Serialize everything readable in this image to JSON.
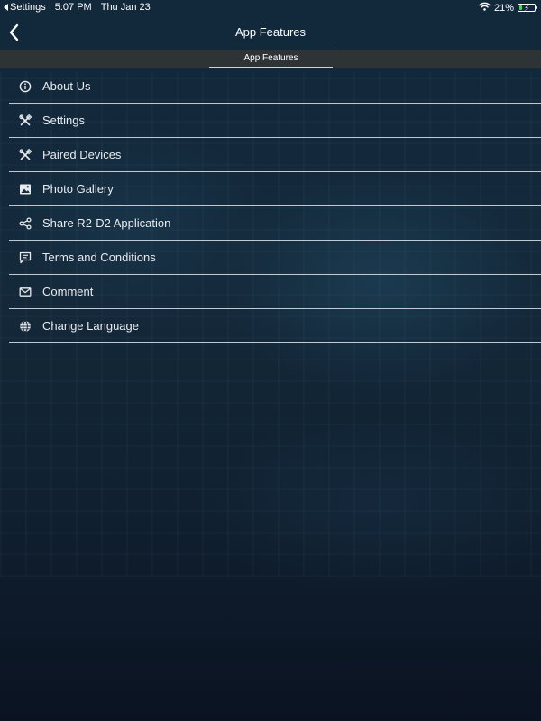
{
  "status_bar": {
    "back_app": "Settings",
    "time": "5:07 PM",
    "date": "Thu Jan 23",
    "battery": "21%",
    "battery_level": 0.21
  },
  "nav": {
    "title": "App Features",
    "back_icon": "chevron-left-icon"
  },
  "segment": {
    "selected": "App Features"
  },
  "menu": {
    "items": [
      {
        "label": "About Us",
        "icon": "info-icon"
      },
      {
        "label": "Settings",
        "icon": "tools-icon"
      },
      {
        "label": "Paired Devices",
        "icon": "tools-icon"
      },
      {
        "label": "Photo Gallery",
        "icon": "image-icon"
      },
      {
        "label": "Share R2-D2 Application",
        "icon": "share-icon"
      },
      {
        "label": "Terms and Conditions",
        "icon": "message-icon"
      },
      {
        "label": "Comment",
        "icon": "mail-icon"
      },
      {
        "label": "Change Language",
        "icon": "globe-icon"
      }
    ]
  },
  "colors": {
    "background_top": "#14293a",
    "background_bottom": "#0b1322",
    "divider": "#c3c9d0",
    "text": "#e8ebef",
    "battery_fill": "#3ddc5a"
  }
}
